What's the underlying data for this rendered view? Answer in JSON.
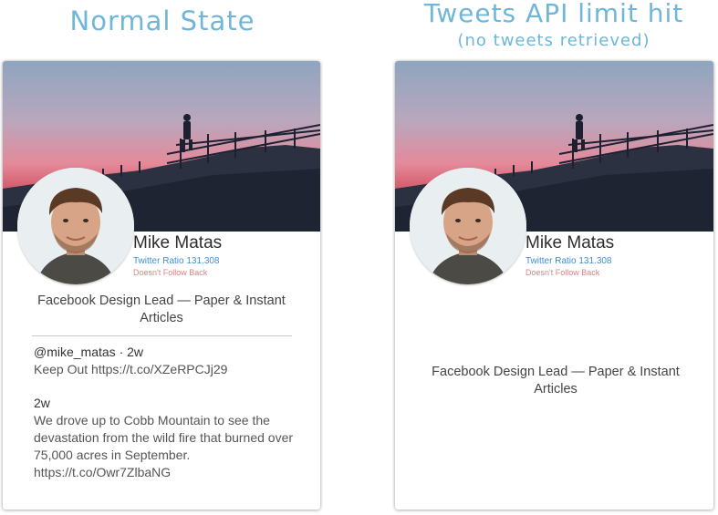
{
  "headings": {
    "left_title": "Normal State",
    "right_title": "Tweets API limit hit",
    "right_subtitle": "(no tweets retrieved)"
  },
  "profile": {
    "name": "Mike Matas",
    "ratio": "Twitter Ratio 131.308",
    "follow_status": "Doesn't Follow Back",
    "bio": "Facebook Design Lead — Paper & Instant Articles"
  },
  "tweets": [
    {
      "meta": "@mike_matas · 2w",
      "text": "Keep Out https://t.co/XZeRPCJj29"
    },
    {
      "meta": "2w",
      "text": "We drove up to Cobb Mountain to see the devastation from the wild fire that burned over 75,000 acres in September. https://t.co/Owr7ZlbaNG"
    }
  ],
  "colors": {
    "heading": "#6fb6d8",
    "ratio": "#3f8fd0",
    "follow_status": "#e97a86"
  }
}
